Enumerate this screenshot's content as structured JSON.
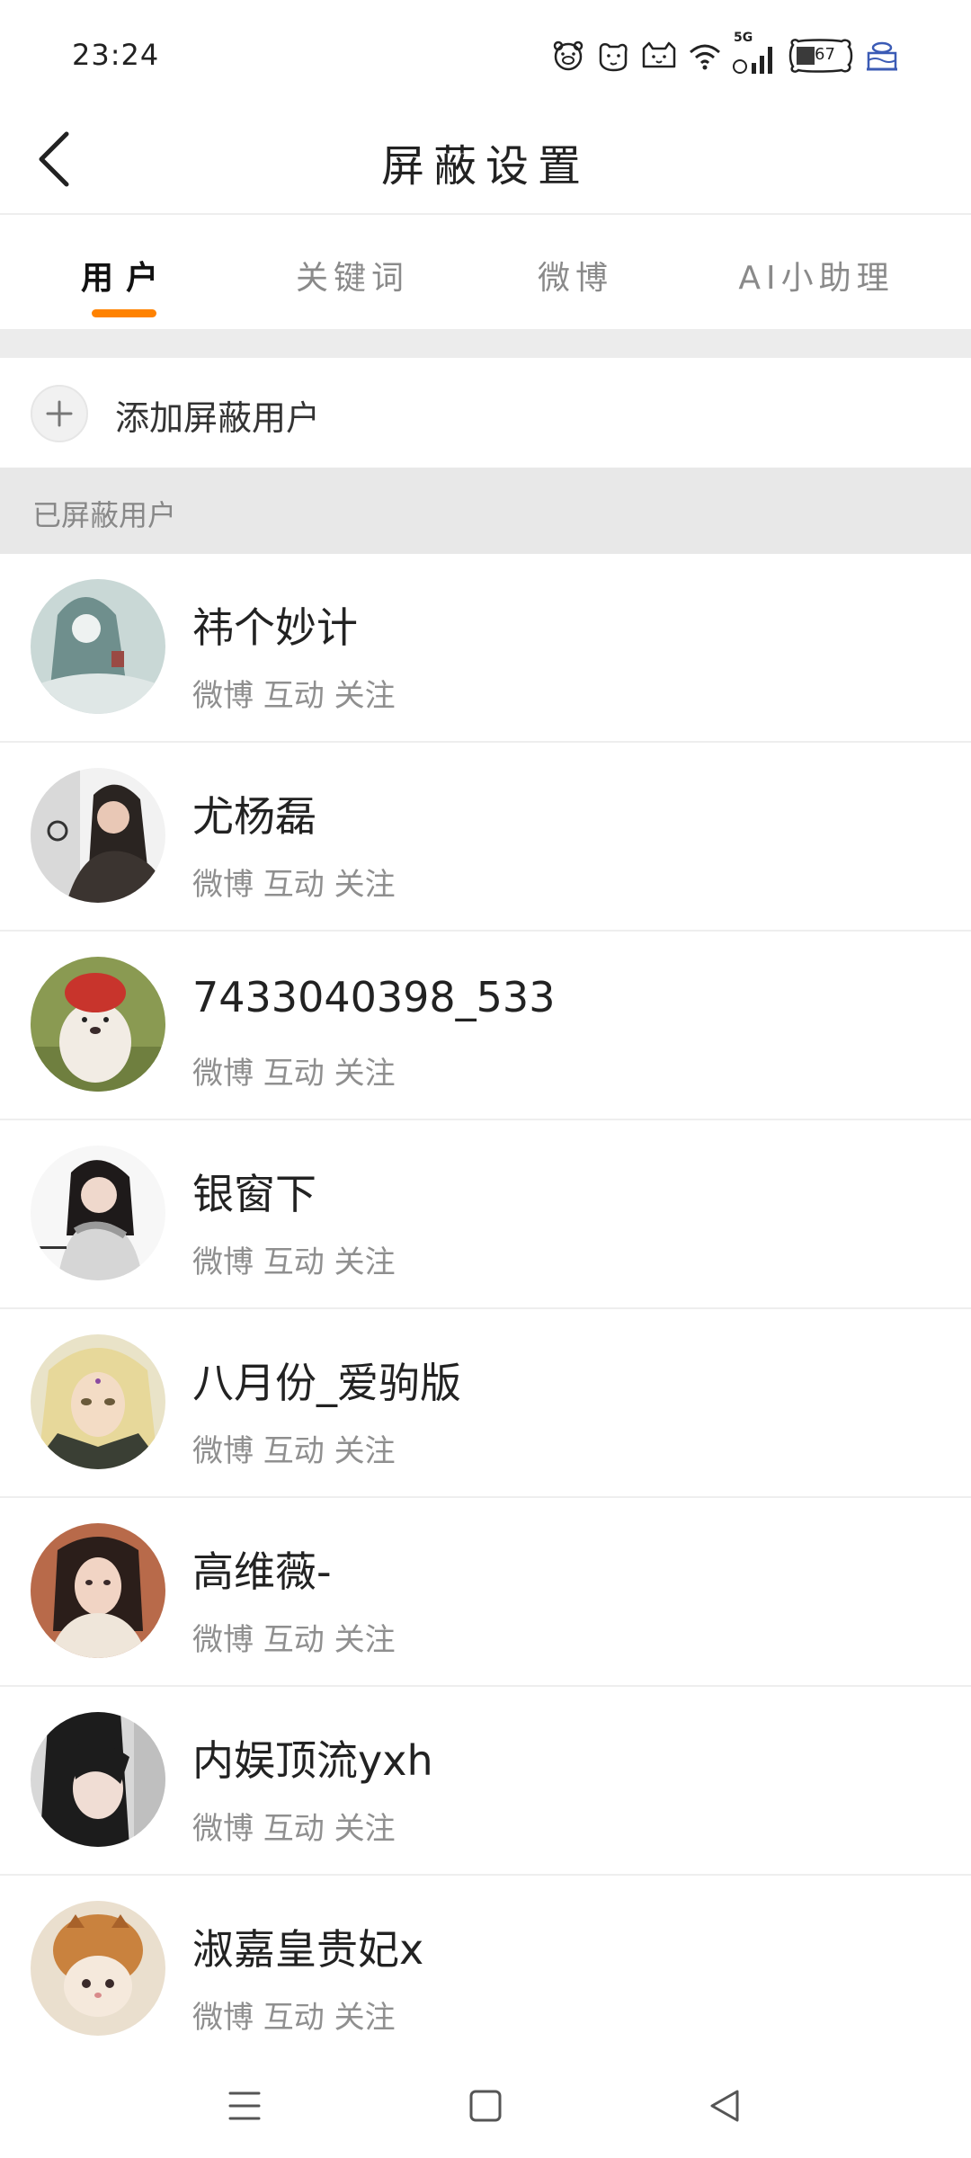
{
  "status_bar": {
    "time": "23:24",
    "network": "5G",
    "battery": "67",
    "icons": [
      "pig-emoji-icon",
      "dog-emoji-icon",
      "cat-emoji-icon",
      "wifi-icon",
      "signal-icon",
      "battery-icon",
      "cake-icon"
    ]
  },
  "header": {
    "title": "屏蔽设置",
    "back_icon": "back-arrow-icon"
  },
  "tabs": [
    {
      "label": "用户",
      "active": true
    },
    {
      "label": "关键词",
      "active": false
    },
    {
      "label": "微博",
      "active": false
    },
    {
      "label": "AI小助理",
      "active": false
    }
  ],
  "accent_color": "#ff8200",
  "add_blocked_user": {
    "icon": "plus-icon",
    "label": "添加屏蔽用户"
  },
  "section_title": "已屏蔽用户",
  "blocked_users": [
    {
      "name": "祎个妙计",
      "meta": "微博 互动 关注"
    },
    {
      "name": "尤杨磊",
      "meta": "微博 互动 关注"
    },
    {
      "name": "7433040398_533",
      "meta": "微博 互动 关注"
    },
    {
      "name": "银窗下",
      "meta": "微博 互动 关注"
    },
    {
      "name": "八月份_爱驹版",
      "meta": "微博 互动 关注"
    },
    {
      "name": "高维薇-",
      "meta": "微博 互动 关注"
    },
    {
      "name": "内娱顶流yxh",
      "meta": "微博 互动 关注"
    },
    {
      "name": "淑嘉皇贵妃x",
      "meta": "微博 互动 关注"
    }
  ],
  "system_nav": {
    "icons": [
      "menu-icon",
      "home-square-icon",
      "back-triangle-icon"
    ]
  }
}
